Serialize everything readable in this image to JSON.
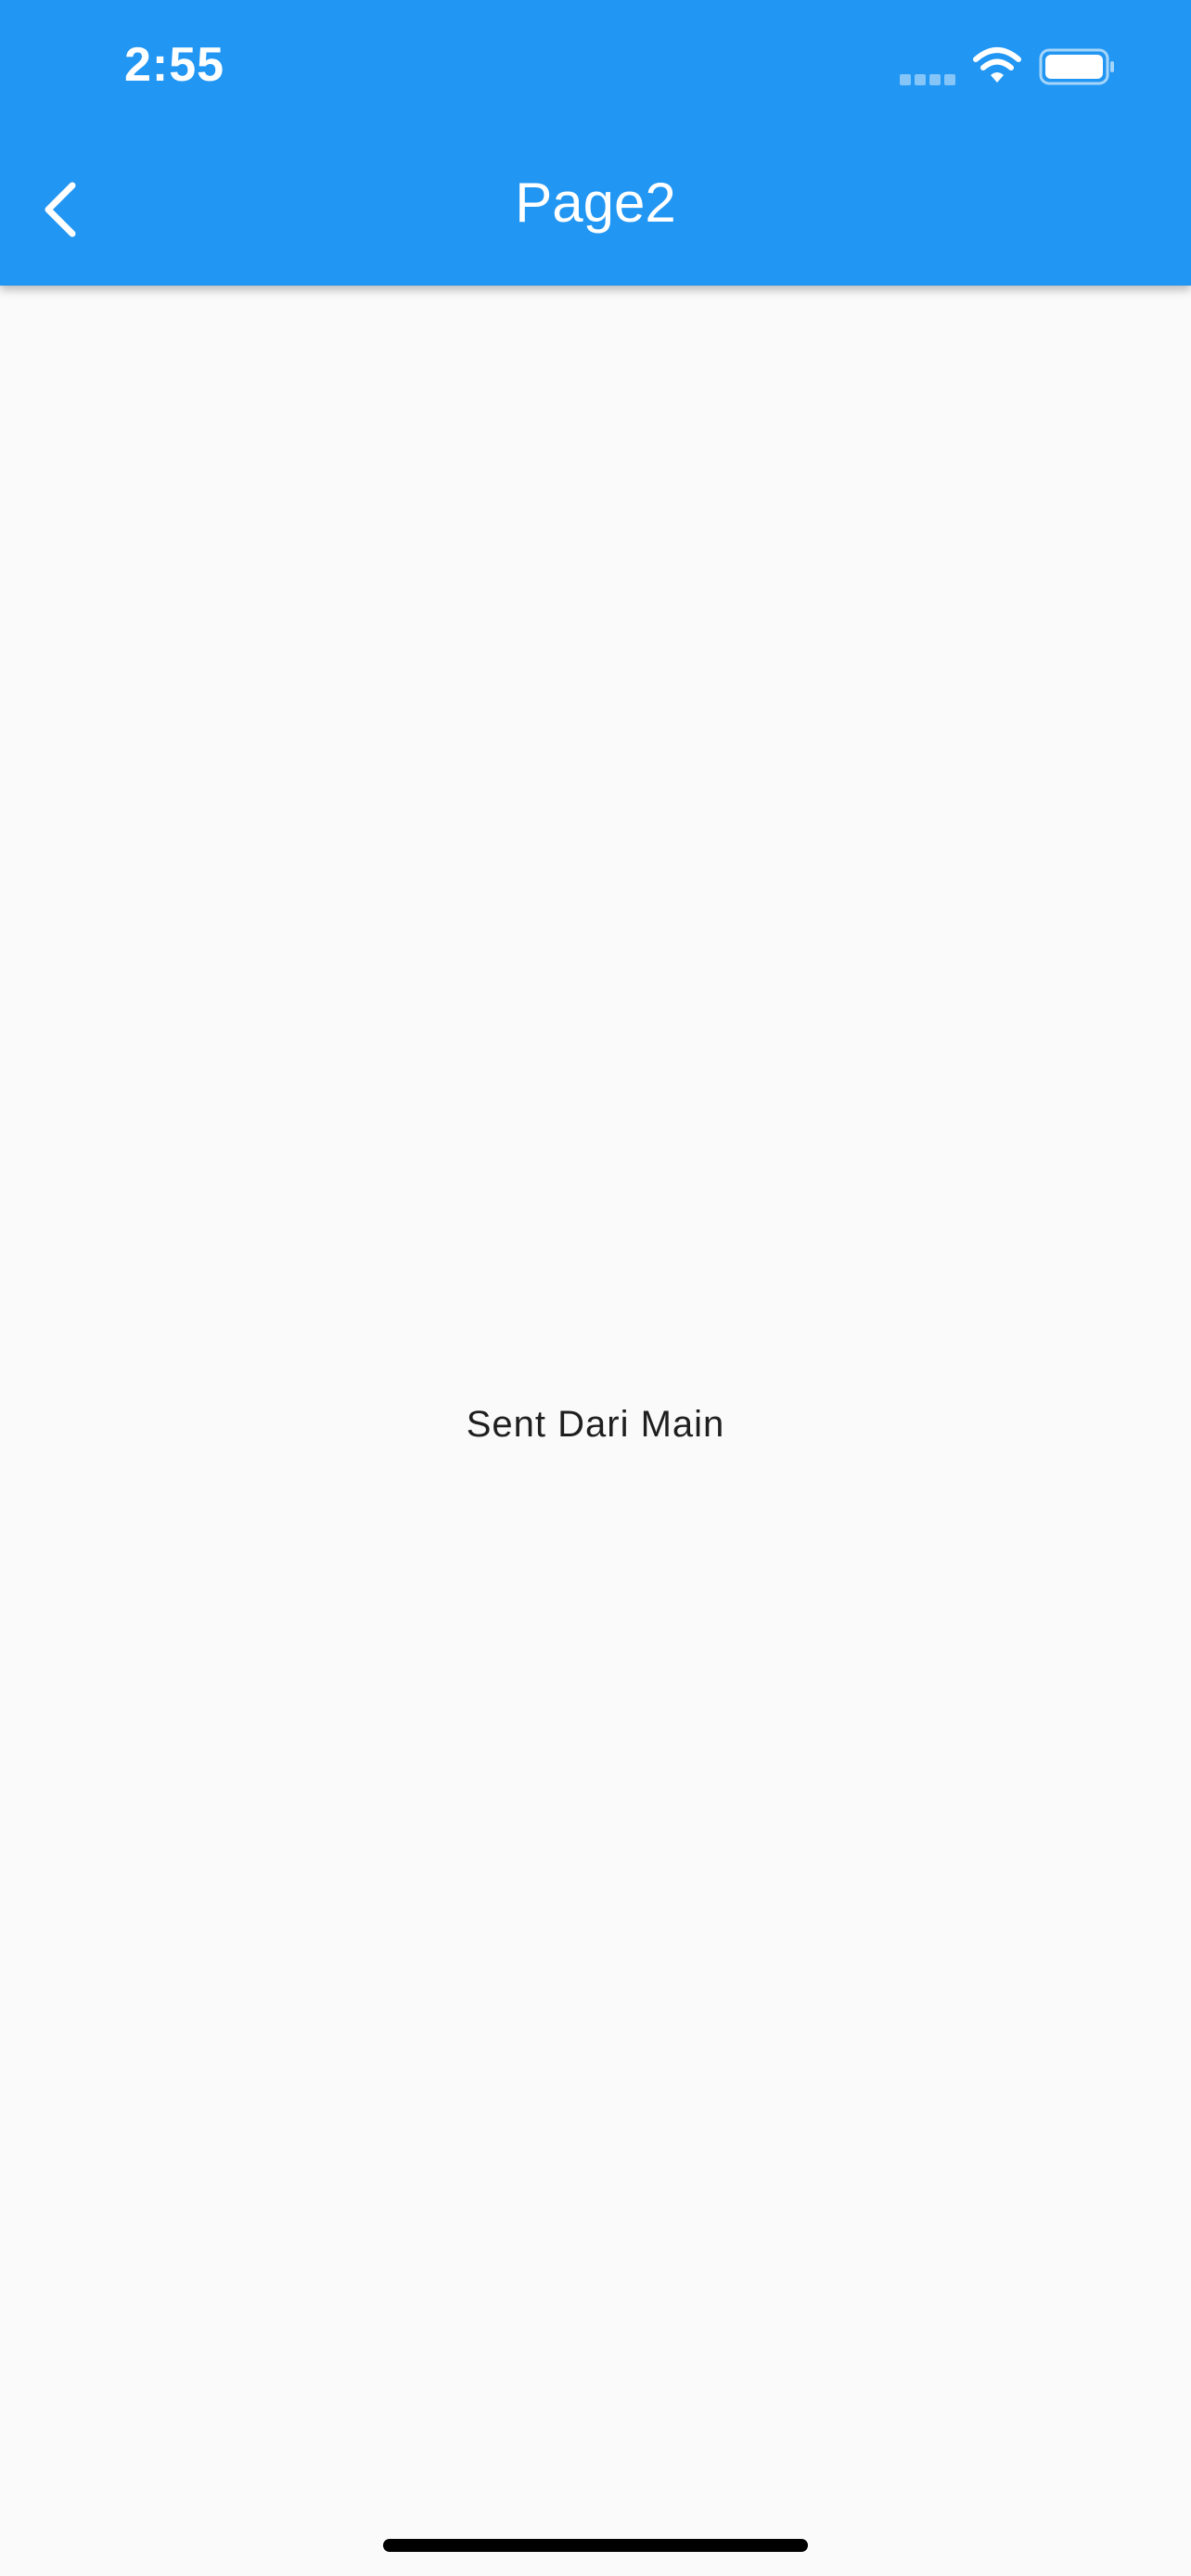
{
  "status_bar": {
    "time": "2:55",
    "icons": [
      "cellular-signal-icon",
      "wifi-icon",
      "battery-icon"
    ]
  },
  "app_bar": {
    "title": "Page2",
    "back_icon": "chevron-left-icon"
  },
  "body": {
    "message": "Sent Dari Main"
  },
  "colors": {
    "app_bar": "#2196f3",
    "background": "#fafafa",
    "text": "#1f1f1f",
    "on_primary": "#ffffff"
  }
}
